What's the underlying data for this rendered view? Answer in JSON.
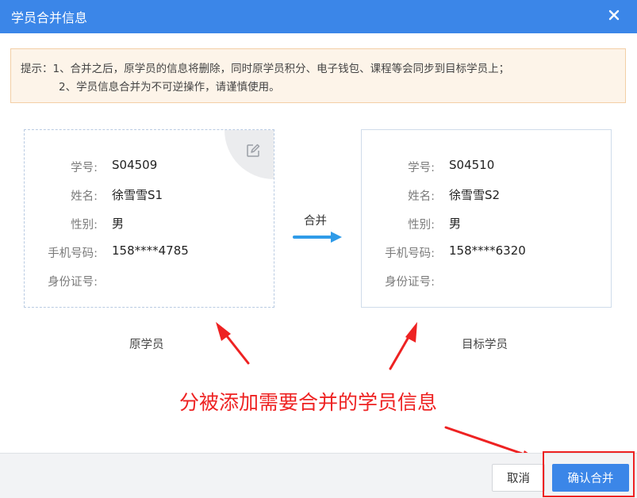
{
  "dialog": {
    "title": "学员合并信息",
    "close_icon": "close-icon"
  },
  "notice": {
    "line1": "提示：1、合并之后，原学员的信息将删除，同时原学员积分、电子钱包、课程等会同步到目标学员上；",
    "line2": "2、学员信息合并为不可逆操作，请谨慎使用。"
  },
  "labels": {
    "student_id": "学号:",
    "name": "姓名:",
    "gender": "性别:",
    "phone": "手机号码:",
    "id_card": "身份证号:"
  },
  "source": {
    "student_id": "S04509",
    "name": "徐雪雪S1",
    "gender": "男",
    "phone": "158****4785",
    "id_card": "",
    "caption": "原学员",
    "edit_icon": "edit-icon"
  },
  "target": {
    "student_id": "S04510",
    "name": "徐雪雪S2",
    "gender": "男",
    "phone": "158****6320",
    "id_card": "",
    "caption": "目标学员"
  },
  "merge": {
    "label": "合并",
    "arrow_icon": "arrow-right-icon"
  },
  "annotation": {
    "text": "分被添加需要合并的学员信息",
    "color": "#ee2222"
  },
  "footer": {
    "cancel_label": "取消",
    "confirm_label": "确认合并"
  },
  "colors": {
    "primary": "#3b86e8",
    "notice_bg": "#fdf4e9",
    "notice_border": "#f3cfa6",
    "annotation": "#ee2222"
  }
}
